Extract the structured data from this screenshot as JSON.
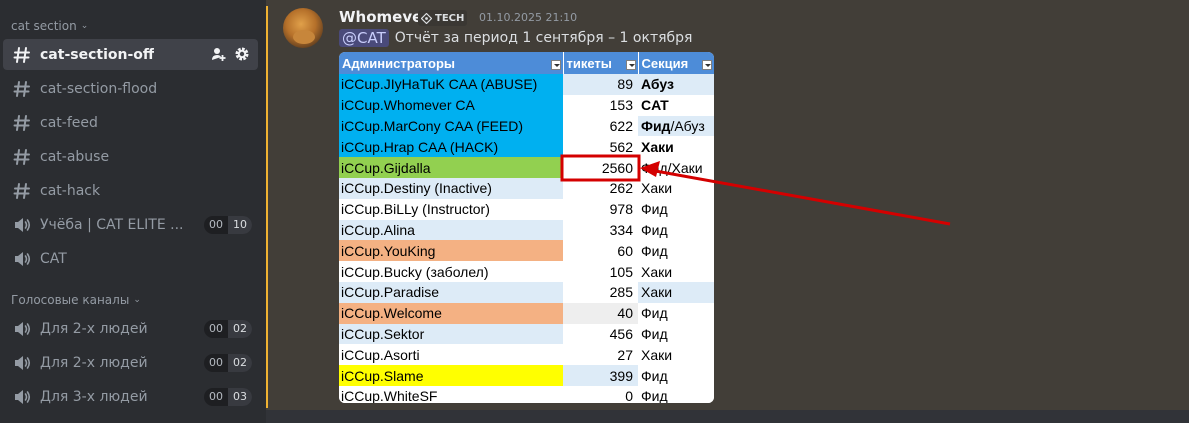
{
  "sidebar": {
    "category_title": "cat section",
    "channels": [
      {
        "name": "cat-section-off",
        "active": true
      },
      {
        "name": "cat-section-flood"
      },
      {
        "name": "cat-feed"
      },
      {
        "name": "cat-abuse"
      },
      {
        "name": "cat-hack"
      }
    ],
    "voice_top": [
      {
        "name": "Учёба | CAT ELITE ...",
        "count": "00",
        "limit": "10"
      },
      {
        "name": "CAT"
      }
    ],
    "voice_category_title": "Голосовые каналы",
    "voice_channels": [
      {
        "name": "Для 2-х людей",
        "count": "00",
        "limit": "02"
      },
      {
        "name": "Для 2-х людей",
        "count": "00",
        "limit": "02"
      },
      {
        "name": "Для 3-х людей",
        "count": "00",
        "limit": "03"
      }
    ]
  },
  "message": {
    "author": "Whomever",
    "tag": "TECH",
    "timestamp": "01.10.2025 21:10",
    "mention": "@CAT",
    "text": "Отчёт за период 1 сентября – 1 октября"
  },
  "spreadsheet": {
    "headers": [
      "Администраторы",
      "тикеты",
      "Секция"
    ],
    "rows": [
      {
        "admin": "iCCup.JIyHaTuK CAA (ABUSE)",
        "tickets": "89",
        "section": "Абуз",
        "section_bold": true,
        "color": "#00b0f0"
      },
      {
        "admin": "iCCup.Whomever CA",
        "tickets": "153",
        "section": "CAT",
        "section_bold": true,
        "color": "#00b0f0"
      },
      {
        "admin": "iCCup.MarCony CAA (FEED)",
        "tickets": "622",
        "section_bold_part": "Фид",
        "section": "/Абуз",
        "color": "#00b0f0"
      },
      {
        "admin": "iCCup.Hrap CAA (HACK)",
        "tickets": "562",
        "section": "Хаки",
        "section_bold": true,
        "color": "#00b0f0"
      },
      {
        "admin": "iCCup.Gijdalla",
        "tickets": "2560",
        "section": "Фид/Хаки",
        "color": "#92d050"
      },
      {
        "admin": "iCCup.Destiny (Inactive)",
        "tickets": "262",
        "section": "Хаки",
        "color": "#ddebf7"
      },
      {
        "admin": "iCCup.BiLLy (Instructor)",
        "tickets": "978",
        "section": "Фид",
        "color": "#ffffff"
      },
      {
        "admin": "iCCup.Alina",
        "tickets": "334",
        "section": "Фид",
        "color": "#ddebf7"
      },
      {
        "admin": "iCCup.YouKing",
        "tickets": "60",
        "section": "Фид",
        "color": "#f4b183"
      },
      {
        "admin": "iCCup.Bucky (заболел)",
        "tickets": "105",
        "section": "Хаки",
        "color": "#ffffff"
      },
      {
        "admin": "iCCup.Paradise",
        "tickets": "285",
        "section": "Хаки",
        "color": "#ddebf7"
      },
      {
        "admin": "iCCup.Welcome",
        "tickets": "40",
        "section": "Фид",
        "color": "#f4b183"
      },
      {
        "admin": "iCCup.Sektor",
        "tickets": "456",
        "section": "Фид",
        "color": "#ddebf7"
      },
      {
        "admin": "iCCup.Asorti",
        "tickets": "27",
        "section": "Хаки",
        "color": "#ffffff"
      },
      {
        "admin": "iCCup.Slame",
        "tickets": "399",
        "section": "Фид",
        "color": "#ffff00"
      },
      {
        "admin": "iCCup.WhiteSF",
        "tickets": "0",
        "section": "Фид",
        "color": "#ffffff"
      }
    ]
  },
  "colors": {
    "accent": "#f0b232",
    "highlight_box": "#d40000"
  }
}
